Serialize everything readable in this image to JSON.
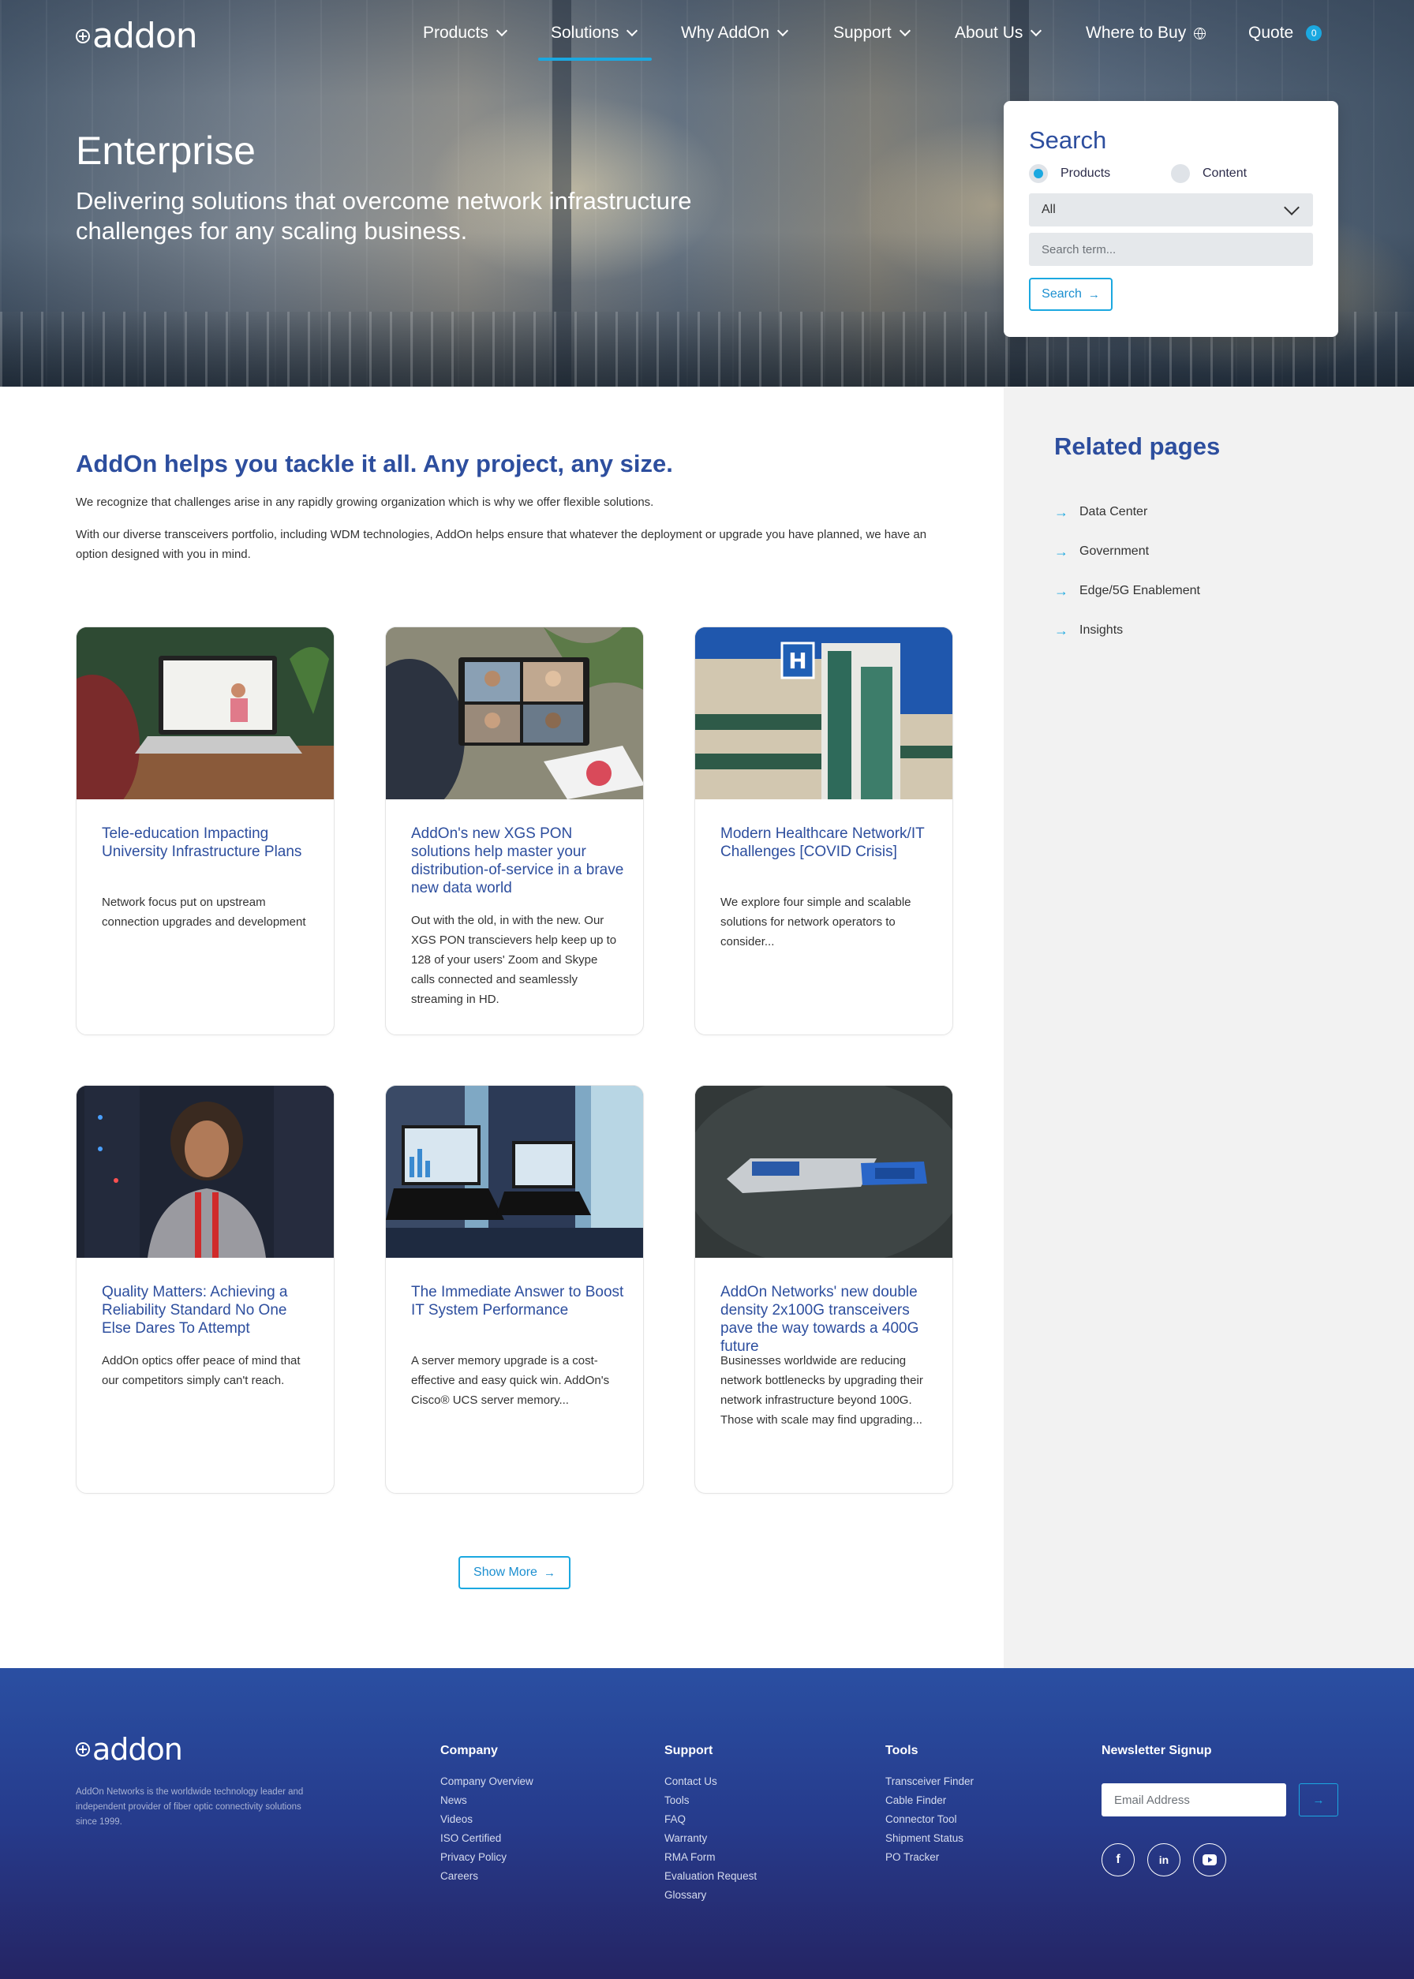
{
  "brand": {
    "logo_text": "addon"
  },
  "nav": {
    "items": [
      {
        "label": "Products"
      },
      {
        "label": "Solutions"
      },
      {
        "label": "Why AddOn"
      },
      {
        "label": "Support"
      },
      {
        "label": "About Us"
      },
      {
        "label": "Where to Buy"
      },
      {
        "label": "Quote"
      }
    ],
    "active_item": "Solutions",
    "quote_count": "0"
  },
  "hero": {
    "title": "Enterprise",
    "subtitle": "Delivering solutions that overcome network infrastructure challenges for any scaling business."
  },
  "search": {
    "title": "Search",
    "radio_products": "Products",
    "radio_content": "Content",
    "selected_radio": "Products",
    "category_selected": "All",
    "input_placeholder": "Search term...",
    "button_label": "Search"
  },
  "intro": {
    "title": "AddOn helps you tackle it all. Any project, any size.",
    "p1": "We recognize that challenges arise in any rapidly growing organization which is why we offer flexible solutions.",
    "p2": "With our diverse transceivers portfolio, including WDM technologies, AddOn helps ensure that whatever the deployment or upgrade you have planned, we have an option designed with you in mind."
  },
  "related": {
    "title": "Related pages",
    "items": [
      "Data Center",
      "Government",
      "Edge/5G Enablement",
      "Insights"
    ]
  },
  "cards": [
    {
      "title": "Tele-education Impacting University Infrastructure Plans",
      "desc": "Network focus put on upstream connection upgrades and development"
    },
    {
      "title": "AddOn's new XGS PON solutions help master your distribution-of-service in a brave new data world",
      "desc": "Out with the old, in with the new. Our XGS PON transcievers help keep up to 128 of your users' Zoom and Skype calls connected and seamlessly streaming in HD."
    },
    {
      "title": "Modern Healthcare Network/IT Challenges [COVID Crisis]",
      "desc": "We explore four simple and scalable solutions for network operators to consider..."
    },
    {
      "title": "Quality Matters: Achieving a Reliability Standard No One Else Dares To Attempt",
      "desc": "AddOn optics offer peace of mind that our competitors simply can't reach."
    },
    {
      "title": "The Immediate Answer to Boost IT System Performance",
      "desc": "A server memory upgrade is a cost-effective and easy quick win. AddOn's Cisco® UCS server memory..."
    },
    {
      "title": "AddOn Networks' new double density 2x100G transceivers pave the way towards a 400G future",
      "desc": "Businesses worldwide are reducing network bottlenecks by upgrading their network infrastructure beyond 100G. Those with scale may find upgrading..."
    }
  ],
  "show_more_label": "Show More",
  "footer": {
    "description": "AddOn Networks is the worldwide technology leader and independent provider of fiber optic connectivity solutions since 1999.",
    "company": {
      "heading": "Company",
      "links": [
        "Company Overview",
        "News",
        "Videos",
        "ISO Certified",
        "Privacy Policy",
        "Careers"
      ]
    },
    "support": {
      "heading": "Support",
      "links": [
        "Contact Us",
        "Tools",
        "FAQ",
        "Warranty",
        "RMA Form",
        "Evaluation Request",
        "Glossary"
      ]
    },
    "tools": {
      "heading": "Tools",
      "links": [
        "Transceiver Finder",
        "Cable Finder",
        "Connector Tool",
        "Shipment Status",
        "PO Tracker"
      ]
    },
    "newsletter": {
      "heading": "Newsletter Signup",
      "placeholder": "Email Address"
    },
    "social": [
      "facebook-icon",
      "linkedin-icon",
      "youtube-icon"
    ]
  },
  "colors": {
    "accent": "#1ba8e0",
    "heading_blue": "#2d4e9e",
    "footer_top": "#2a4fa2",
    "footer_bottom": "#252463",
    "sidebar_bg": "#f2f2f2"
  }
}
